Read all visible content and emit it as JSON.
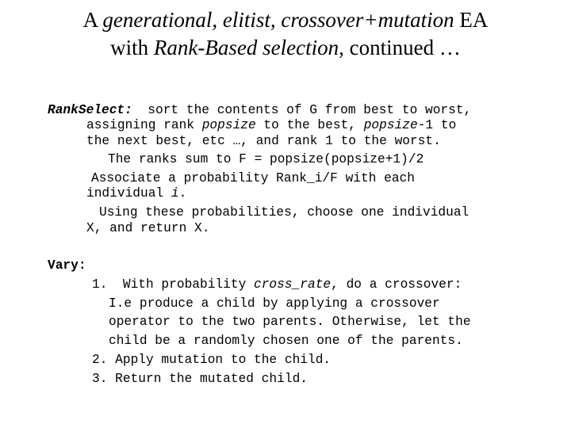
{
  "title": {
    "line1": {
      "prefix": "A ",
      "italic": "generational, elitist, crossover+mutation",
      "suffix": " EA"
    },
    "line2": {
      "prefix": "with ",
      "italic": "Rank-Based selection,",
      "suffix": " continued …"
    }
  },
  "rank_select": {
    "label": "RankSelect:",
    "line1": "  sort the contents of G from best to worst,",
    "line2": {
      "a": "assigning rank ",
      "b": "popsize",
      "c": " to the best, ",
      "d": "popsize",
      "e": "-1 to"
    },
    "line3": "the next best, etc …, and rank 1 to the worst.",
    "line4": "The ranks sum to F = popsize(popsize+1)/2",
    "line5": "Associate a probability Rank_i/F with each",
    "line6": {
      "a": "individual ",
      "b": "i",
      "c": "."
    },
    "line7": "Using these probabilities, choose one individual",
    "line8": "X, and return X."
  },
  "vary": {
    "label": "Vary:",
    "step1": {
      "a": "1.  With probability ",
      "b": "cross_rate",
      "c": ", do a crossover:"
    },
    "step1_cont": [
      "I.e produce a child by applying a crossover",
      "operator to the two parents. Otherwise, let the",
      "child be a randomly chosen one of the parents."
    ],
    "step2": "2. Apply mutation to the child.",
    "step3": "3. Return the mutated child."
  }
}
